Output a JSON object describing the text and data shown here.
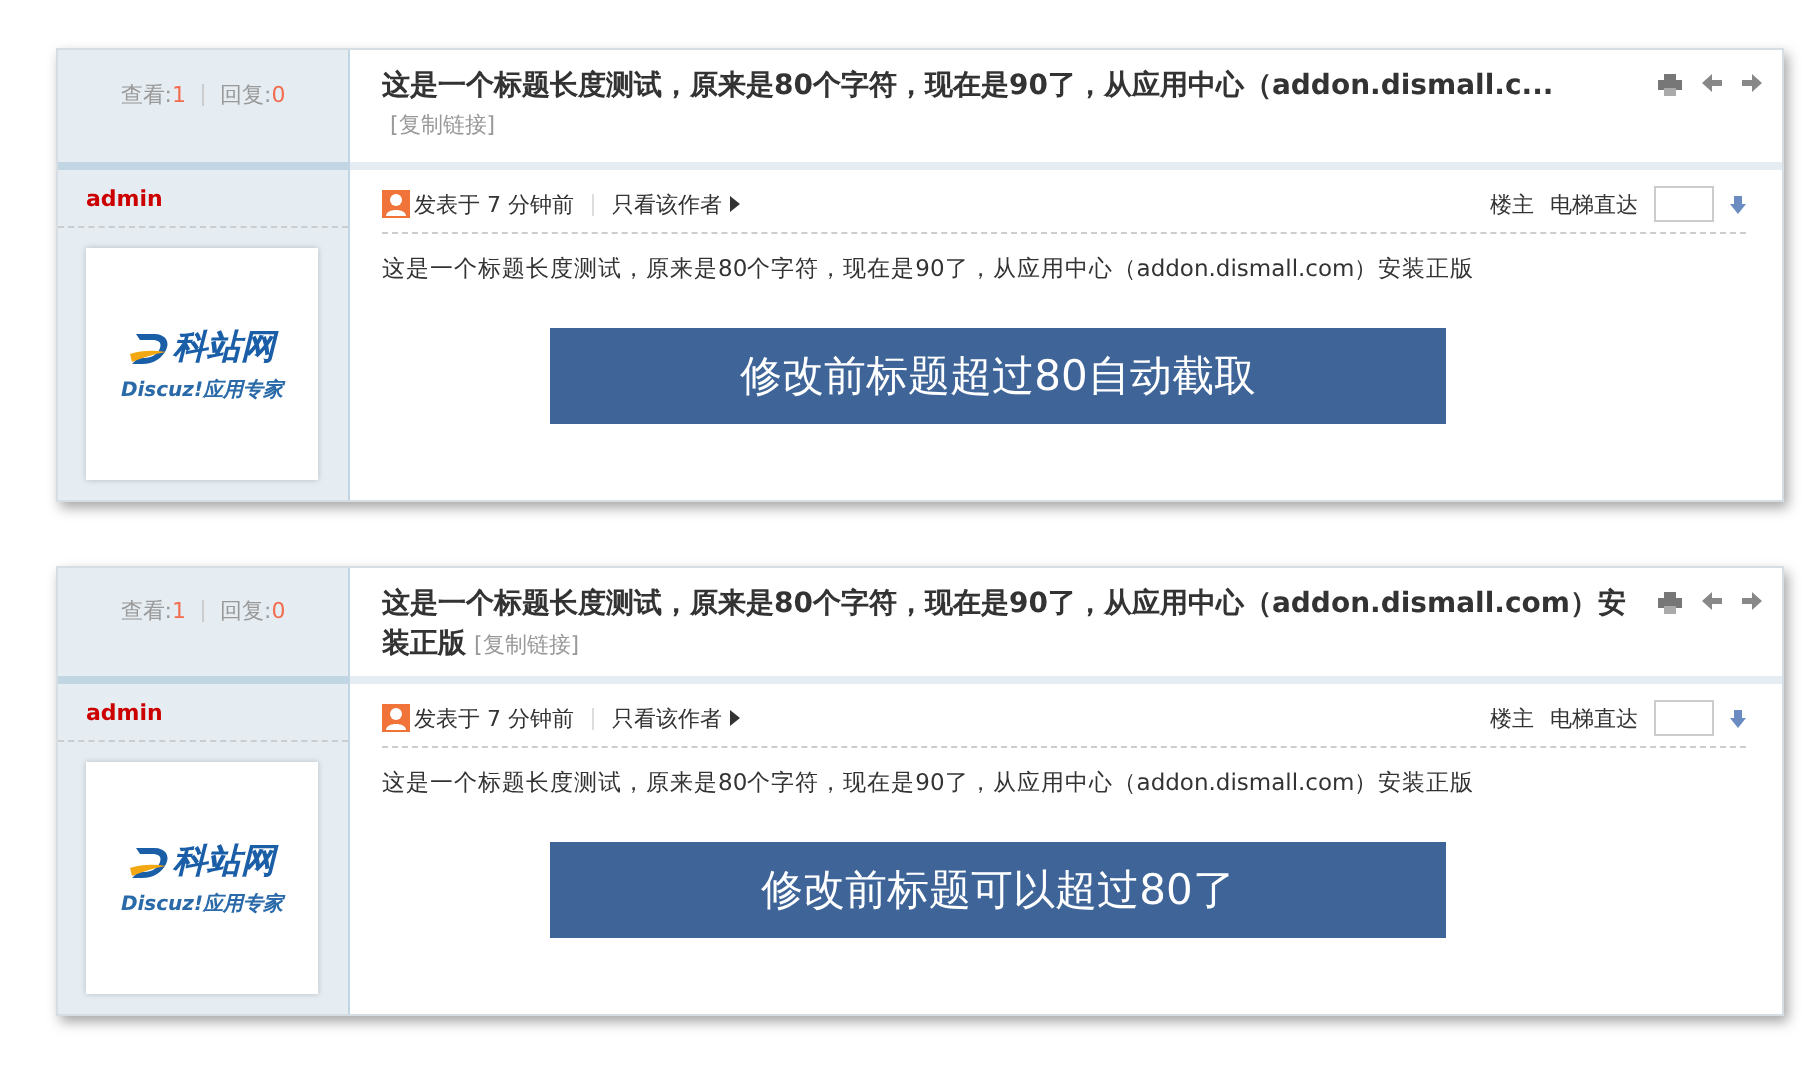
{
  "posts": [
    {
      "stats": {
        "views_label": "查看:",
        "views": "1",
        "replies_label": "回复:",
        "replies": "0"
      },
      "title_lines": [
        "这是一个标题长度测试，原来是80个字符，现在是90了，从应用中心（addon.dismall.c..."
      ],
      "copy_link": "[复制链接]",
      "author": "admin",
      "posted": "发表于 7 分钟前",
      "only_author": "只看该作者",
      "floor": "楼主",
      "jump_label": "电梯直达",
      "logo": {
        "name": "科站网",
        "tagline": "Discuz!应用专家"
      },
      "body": "这是一个标题长度测试，原来是80个字符，现在是90了，从应用中心（addon.dismall.com）安装正版",
      "banner": "修改前标题超过80自动截取"
    },
    {
      "stats": {
        "views_label": "查看:",
        "views": "1",
        "replies_label": "回复:",
        "replies": "0"
      },
      "title_lines": [
        "这是一个标题长度测试，原来是80个字符，现在是90了，从应用中心（addon.dismall.com）安",
        "装正版"
      ],
      "copy_link": "[复制链接]",
      "author": "admin",
      "posted": "发表于 7 分钟前",
      "only_author": "只看该作者",
      "floor": "楼主",
      "jump_label": "电梯直达",
      "logo": {
        "name": "科站网",
        "tagline": "Discuz!应用专家"
      },
      "body": "这是一个标题长度测试，原来是80个字符，现在是90了，从应用中心（addon.dismall.com）安装正版",
      "banner": "修改前标题可以超过80了"
    }
  ]
}
